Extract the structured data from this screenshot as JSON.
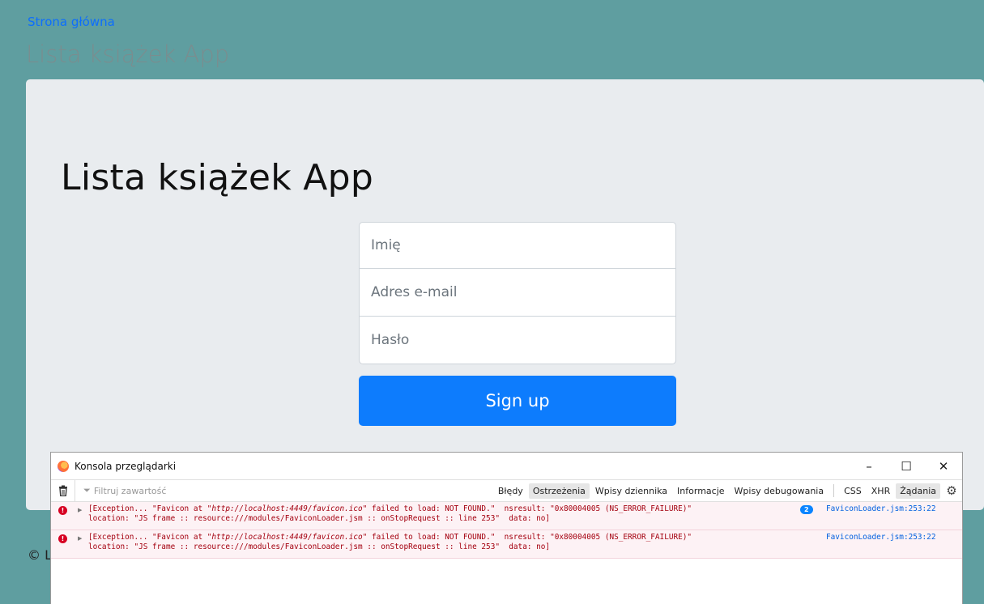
{
  "header": {
    "home_link": "Strona główna",
    "brand": "Lista książek App"
  },
  "jumbotron": {
    "title": "Lista książek App"
  },
  "form": {
    "name_placeholder": "Imię",
    "email_placeholder": "Adres e-mail",
    "password_placeholder": "Hasło",
    "submit_label": "Sign up"
  },
  "footer": {
    "copyright": "© L"
  },
  "console": {
    "title": "Konsola przeglądarki",
    "controls": {
      "minimize": "–",
      "maximize": "☐",
      "close": "✕"
    },
    "filter_placeholder": "Filtruj zawartość",
    "tabs": [
      "Błędy",
      "Ostrzeżenia",
      "Wpisy dziennika",
      "Informacje",
      "Wpisy debugowania",
      "CSS",
      "XHR",
      "Żądania"
    ],
    "active_tabs": [
      "Ostrzeżenia",
      "Żądania"
    ],
    "messages": [
      {
        "line1_prefix": "[Exception... \"Favicon at \"",
        "url": "http://localhost:4449/favicon.ico",
        "line1_suffix": "\" failed to load: NOT FOUND.\"  nsresult: \"0x80004005 (NS_ERROR_FAILURE)\"",
        "line2": "location: \"JS frame :: resource:///modules/FaviconLoader.jsm :: onStopRequest :: line 253\"  data: no]",
        "repeat": "2",
        "source": "FaviconLoader.jsm:253:22"
      },
      {
        "line1_prefix": "[Exception... \"Favicon at \"",
        "url": "http://localhost:4449/favicon.ico",
        "line1_suffix": "\" failed to load: NOT FOUND.\"  nsresult: \"0x80004005 (NS_ERROR_FAILURE)\"",
        "line2": "location: \"JS frame :: resource:///modules/FaviconLoader.jsm :: onStopRequest :: line 253\"  data: no]",
        "repeat": "",
        "source": "FaviconLoader.jsm:253:22"
      }
    ]
  },
  "colors": {
    "page_bg": "#5f9ea0",
    "jumbotron_bg": "#e9ecef",
    "primary": "#0d7cfd",
    "error": "#d70022"
  }
}
